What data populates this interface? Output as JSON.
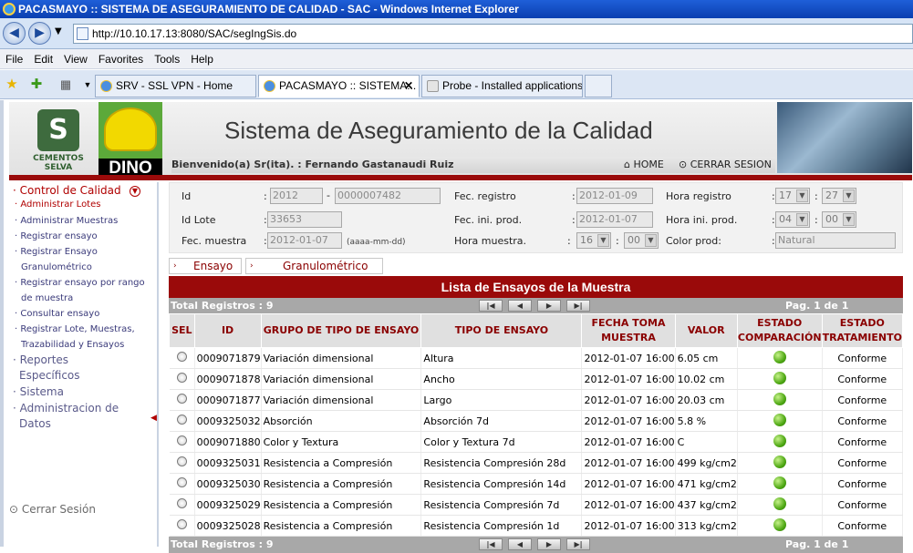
{
  "browser": {
    "title": "PACASMAYO :: SISTEMA DE ASEGURAMIENTO DE CALIDAD - SAC - Windows Internet Explorer",
    "url": "http://10.10.17.13:8080/SAC/segIngSis.do",
    "menu": [
      "File",
      "Edit",
      "View",
      "Favorites",
      "Tools",
      "Help"
    ],
    "tabs": [
      {
        "label": "SRV - SSL VPN - Home"
      },
      {
        "label": "PACASMAYO :: SISTEMA..."
      },
      {
        "label": "Probe - Installed applications"
      }
    ]
  },
  "header": {
    "logo_text": "CEMENTOS SELVA",
    "dino_text": "DINO",
    "title": "Sistema de Aseguramiento de la Calidad",
    "welcome": "Bienvenido(a) Sr(ita). : Fernando Gastanaudi Ruiz",
    "home": "HOME",
    "logout": "CERRAR SESION"
  },
  "sidebar": {
    "control": "Control de Calidad",
    "items": [
      "Administrar Lotes",
      "Administrar Muestras",
      "Registrar ensayo",
      "Registrar Ensayo",
      "Granulométrico",
      "Registrar ensayo por rango",
      "de muestra",
      "Consultar ensayo",
      "Registrar Lote, Muestras,",
      "Trazabilidad y Ensayos"
    ],
    "reportes_1": "Reportes",
    "reportes_2": "Específicos",
    "sistema": "Sistema",
    "admin_1": "Administracion de",
    "admin_2": "Datos",
    "cerrar": "Cerrar Sesión"
  },
  "form": {
    "id_label": "Id",
    "id_year": "2012",
    "id_num": "0000007482",
    "fec_registro_label": "Fec. registro",
    "fec_registro": "2012-01-09",
    "hora_registro_label": "Hora registro",
    "hora_registro_h": "17",
    "hora_registro_m": "27",
    "id_lote_label": "Id Lote",
    "id_lote": "33653",
    "fec_ini_label": "Fec. ini. prod.",
    "fec_ini": "2012-01-07",
    "hora_ini_label": "Hora ini. prod.",
    "hora_ini_h": "04",
    "hora_ini_m": "00",
    "fec_muestra_label": "Fec. muestra",
    "fec_muestra": "2012-01-07",
    "fec_format": "(aaaa-mm-dd)",
    "hora_muestra_label": "Hora muestra.",
    "hora_muestra_h": "16",
    "hora_muestra_m": "00",
    "color_label": "Color prod:",
    "color": "Natural"
  },
  "tabs": {
    "ensayo": "Ensayo",
    "granulo": "Granulométrico"
  },
  "list": {
    "title": "Lista de Ensayos de la Muestra",
    "total": "Total Registros : 9",
    "page": "Pag. 1 de 1",
    "headers": {
      "sel": "SEL",
      "id": "ID",
      "grupo": "GRUPO DE TIPO DE ENSAYO",
      "tipo": "TIPO DE ENSAYO",
      "fecha_1": "FECHA TOMA",
      "fecha_2": "MUESTRA",
      "valor": "VALOR",
      "estado_c_1": "ESTADO",
      "estado_c_2": "COMPARACIÓN",
      "estado_t_1": "ESTADO",
      "estado_t_2": "TRATAMIENTO"
    },
    "rows": [
      {
        "id": "0009071879",
        "grupo": "Variación dimensional",
        "tipo": "Altura",
        "fecha": "2012-01-07 16:00",
        "valor": "6.05 cm",
        "estado": "Conforme"
      },
      {
        "id": "0009071878",
        "grupo": "Variación dimensional",
        "tipo": "Ancho",
        "fecha": "2012-01-07 16:00",
        "valor": "10.02 cm",
        "estado": "Conforme"
      },
      {
        "id": "0009071877",
        "grupo": "Variación dimensional",
        "tipo": "Largo",
        "fecha": "2012-01-07 16:00",
        "valor": "20.03 cm",
        "estado": "Conforme"
      },
      {
        "id": "0009325032",
        "grupo": "Absorción",
        "tipo": "Absorción 7d",
        "fecha": "2012-01-07 16:00",
        "valor": "5.8 %",
        "estado": "Conforme"
      },
      {
        "id": "0009071880",
        "grupo": "Color y Textura",
        "tipo": "Color y Textura 7d",
        "fecha": "2012-01-07 16:00",
        "valor": "C",
        "estado": "Conforme"
      },
      {
        "id": "0009325031",
        "grupo": "Resistencia a Compresión",
        "tipo": "Resistencia Compresión 28d",
        "fecha": "2012-01-07 16:00",
        "valor": "499 kg/cm2",
        "estado": "Conforme"
      },
      {
        "id": "0009325030",
        "grupo": "Resistencia a Compresión",
        "tipo": "Resistencia Compresión 14d",
        "fecha": "2012-01-07 16:00",
        "valor": "471 kg/cm2",
        "estado": "Conforme"
      },
      {
        "id": "0009325029",
        "grupo": "Resistencia a Compresión",
        "tipo": "Resistencia Compresión 7d",
        "fecha": "2012-01-07 16:00",
        "valor": "437 kg/cm2",
        "estado": "Conforme"
      },
      {
        "id": "0009325028",
        "grupo": "Resistencia a Compresión",
        "tipo": "Resistencia Compresión 1d",
        "fecha": "2012-01-07 16:00",
        "valor": "313 kg/cm2",
        "estado": "Conforme"
      }
    ]
  }
}
